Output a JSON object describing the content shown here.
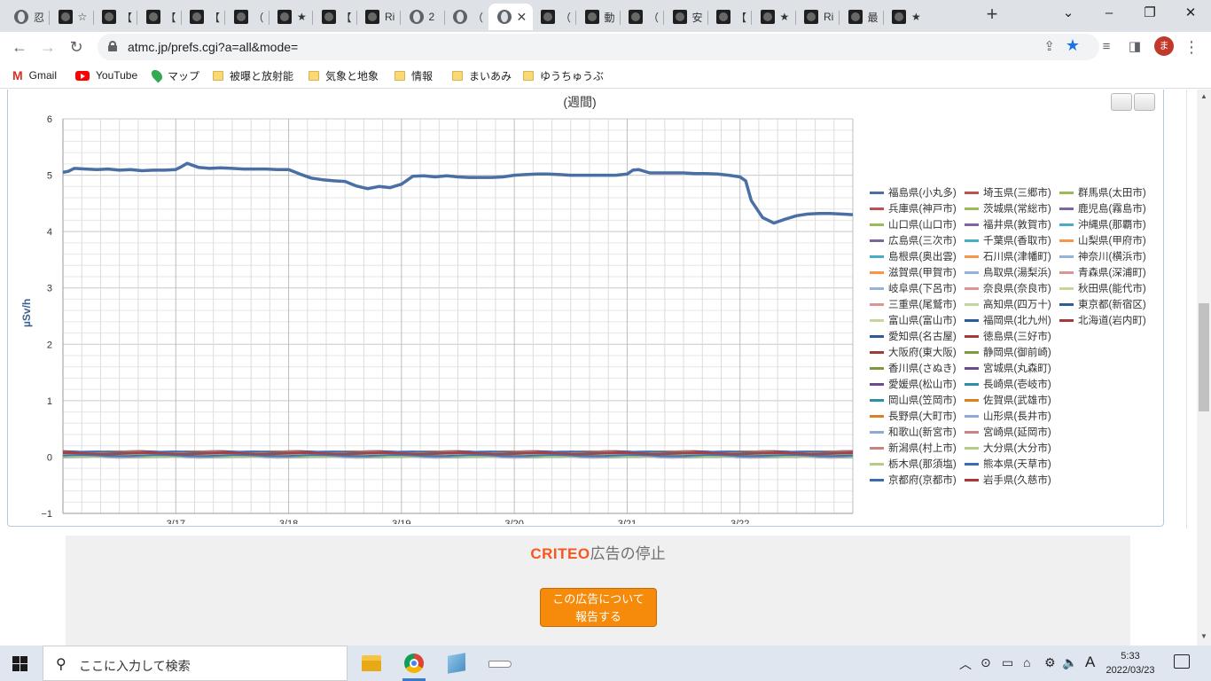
{
  "browser": {
    "tabs": [
      {
        "title": "忍",
        "icon": "globe-icon"
      },
      {
        "title": "☆",
        "icon": "site-favicon-icon"
      },
      {
        "title": "【",
        "icon": "site-favicon-icon"
      },
      {
        "title": "【",
        "icon": "site-favicon-icon"
      },
      {
        "title": "【",
        "icon": "site-favicon-icon"
      },
      {
        "title": "（",
        "icon": "site-favicon-icon"
      },
      {
        "title": "★",
        "icon": "site-favicon-icon"
      },
      {
        "title": "【",
        "icon": "site-favicon-icon"
      },
      {
        "title": "Ri",
        "icon": "site-favicon-icon"
      },
      {
        "title": "2",
        "icon": "globe-icon"
      },
      {
        "title": "（",
        "icon": "globe-icon"
      },
      {
        "title": "",
        "icon": "globe-icon",
        "active": true
      },
      {
        "title": "（",
        "icon": "site-favicon-icon"
      },
      {
        "title": "動",
        "icon": "site-favicon-icon"
      },
      {
        "title": "（",
        "icon": "site-favicon-icon"
      },
      {
        "title": "安",
        "icon": "site-favicon-icon"
      },
      {
        "title": "【",
        "icon": "site-favicon-icon"
      },
      {
        "title": "★",
        "icon": "site-favicon-icon"
      },
      {
        "title": "Ri",
        "icon": "site-favicon-icon"
      },
      {
        "title": "最",
        "icon": "site-favicon-icon"
      },
      {
        "title": "★",
        "icon": "site-favicon-icon"
      }
    ],
    "url": "atmc.jp/prefs.cgi?a=all&mode=",
    "profile_initial": "ま",
    "bookmarks": [
      {
        "label": "Gmail",
        "icon": "gmail-icon"
      },
      {
        "label": "YouTube",
        "icon": "youtube-icon"
      },
      {
        "label": "マップ",
        "icon": "maps-icon"
      },
      {
        "label": "被曝と放射能",
        "icon": "folder-icon"
      },
      {
        "label": "気象と地象",
        "icon": "folder-icon"
      },
      {
        "label": "情報",
        "icon": "folder-icon"
      },
      {
        "label": "まいあみ",
        "icon": "folder-icon"
      },
      {
        "label": "ゆうちゅうぶ",
        "icon": "folder-icon"
      }
    ]
  },
  "chart_data": {
    "type": "line",
    "title": "(週間)",
    "ylabel": "µSv/h",
    "xlabel": "",
    "ylim": [
      -1,
      6
    ],
    "yticks": [
      "6",
      "5",
      "4",
      "3",
      "2",
      "1",
      "0",
      "−1"
    ],
    "xticks": [
      "3/17",
      "3/18",
      "3/19",
      "3/20",
      "3/21",
      "3/22"
    ],
    "grid": true,
    "legend_position": "right",
    "series": [
      {
        "name": "福島県(小丸多)",
        "color": "#4a6fa5",
        "x": [
          16.0,
          16.05,
          16.1,
          16.2,
          16.3,
          16.4,
          16.5,
          16.6,
          16.7,
          16.8,
          16.9,
          17.0,
          17.05,
          17.1,
          17.2,
          17.3,
          17.4,
          17.5,
          17.6,
          17.7,
          17.8,
          17.9,
          18.0,
          18.1,
          18.2,
          18.3,
          18.4,
          18.5,
          18.6,
          18.7,
          18.8,
          18.9,
          19.0,
          19.1,
          19.2,
          19.3,
          19.4,
          19.5,
          19.6,
          19.7,
          19.8,
          19.9,
          20.0,
          20.1,
          20.2,
          20.3,
          20.4,
          20.5,
          20.6,
          20.7,
          20.8,
          20.9,
          21.0,
          21.05,
          21.1,
          21.2,
          21.3,
          21.4,
          21.5,
          21.6,
          21.7,
          21.8,
          21.9,
          22.0,
          22.05,
          22.1,
          22.2,
          22.3,
          22.4,
          22.5,
          22.6,
          22.7,
          22.8,
          22.9,
          23.0
        ],
        "y": [
          5.05,
          5.07,
          5.12,
          5.11,
          5.1,
          5.11,
          5.09,
          5.1,
          5.08,
          5.09,
          5.09,
          5.1,
          5.15,
          5.21,
          5.14,
          5.12,
          5.13,
          5.12,
          5.11,
          5.11,
          5.11,
          5.1,
          5.1,
          5.02,
          4.95,
          4.92,
          4.9,
          4.89,
          4.81,
          4.76,
          4.8,
          4.78,
          4.84,
          4.98,
          4.99,
          4.97,
          4.99,
          4.97,
          4.96,
          4.96,
          4.96,
          4.97,
          5.0,
          5.01,
          5.02,
          5.02,
          5.01,
          5.0,
          5.0,
          5.0,
          5.0,
          5.0,
          5.02,
          5.09,
          5.1,
          5.04,
          5.04,
          5.04,
          5.04,
          5.03,
          5.03,
          5.02,
          5.0,
          4.97,
          4.9,
          4.55,
          4.25,
          4.15,
          4.22,
          4.28,
          4.31,
          4.32,
          4.32,
          4.31,
          4.3
        ]
      },
      {
        "name": "埼玉県(三郷市)",
        "color": "#c0504d"
      },
      {
        "name": "群馬県(太田市)",
        "color": "#9bbb59"
      },
      {
        "name": "兵庫県(神戸市)",
        "color": "#c0504d"
      },
      {
        "name": "茨城県(常総市)",
        "color": "#9bbb59"
      },
      {
        "name": "鹿児島(霧島市)",
        "color": "#8064a2"
      },
      {
        "name": "山口県(山口市)",
        "color": "#9bbb59"
      },
      {
        "name": "福井県(敦賀市)",
        "color": "#8064a2"
      },
      {
        "name": "沖縄県(那覇市)",
        "color": "#4bacc6"
      },
      {
        "name": "広島県(三次市)",
        "color": "#8064a2"
      },
      {
        "name": "千葉県(香取市)",
        "color": "#4bacc6"
      },
      {
        "name": "山梨県(甲府市)",
        "color": "#f79646"
      },
      {
        "name": "島根県(奥出雲)",
        "color": "#4bacc6"
      },
      {
        "name": "石川県(津幡町)",
        "color": "#f79646"
      },
      {
        "name": "神奈川(横浜市)",
        "color": "#95b3d7"
      },
      {
        "name": "滋賀県(甲賀市)",
        "color": "#f79646"
      },
      {
        "name": "鳥取県(湯梨浜)",
        "color": "#95b3d7"
      },
      {
        "name": "青森県(深浦町)",
        "color": "#d99694"
      },
      {
        "name": "岐阜県(下呂市)",
        "color": "#95b3d7"
      },
      {
        "name": "奈良県(奈良市)",
        "color": "#d99694"
      },
      {
        "name": "秋田県(能代市)",
        "color": "#c3d69b"
      },
      {
        "name": "三重県(尾鷲市)",
        "color": "#d99694"
      },
      {
        "name": "高知県(四万十)",
        "color": "#c3d69b"
      },
      {
        "name": "東京都(新宿区)",
        "color": "#2e5b9a"
      },
      {
        "name": "富山県(富山市)",
        "color": "#c3d69b"
      },
      {
        "name": "福岡県(北九州)",
        "color": "#2e5b9a"
      },
      {
        "name": "北海道(岩内町)",
        "color": "#a33b3b"
      },
      {
        "name": "愛知県(名古屋)",
        "color": "#2e5b9a"
      },
      {
        "name": "徳島県(三好市)",
        "color": "#a33b3b"
      },
      {
        "name": "大阪府(東大阪)",
        "color": "#a33b3b"
      },
      {
        "name": "静岡県(御前崎)",
        "color": "#7a9a3b"
      },
      {
        "name": "香川県(さぬき)",
        "color": "#7a9a3b"
      },
      {
        "name": "宮城県(丸森町)",
        "color": "#6a4c8c"
      },
      {
        "name": "愛媛県(松山市)",
        "color": "#6a4c8c"
      },
      {
        "name": "長崎県(壱岐市)",
        "color": "#2f8fa8"
      },
      {
        "name": "岡山県(笠岡市)",
        "color": "#2f8fa8"
      },
      {
        "name": "佐賀県(武雄市)",
        "color": "#e07f22"
      },
      {
        "name": "長野県(大町市)",
        "color": "#e07f22"
      },
      {
        "name": "山形県(長井市)",
        "color": "#8eaad4"
      },
      {
        "name": "和歌山(新宮市)",
        "color": "#8eaad4"
      },
      {
        "name": "宮崎県(延岡市)",
        "color": "#c98482"
      },
      {
        "name": "新潟県(村上市)",
        "color": "#c98482"
      },
      {
        "name": "大分県(大分市)",
        "color": "#b3cc86"
      },
      {
        "name": "栃木県(那須塩)",
        "color": "#b3cc86"
      },
      {
        "name": "熊本県(天草市)",
        "color": "#3a6cb3"
      },
      {
        "name": "京都府(京都市)",
        "color": "#3a6cb3"
      },
      {
        "name": "岩手県(久慈市)",
        "color": "#b03434"
      }
    ],
    "other_series_range": [
      0.0,
      0.12
    ]
  },
  "ad": {
    "brand": "CRITEO",
    "stop_text": "広告の停止",
    "report_button": [
      "この広告について",
      "報告する"
    ]
  },
  "taskbar": {
    "search_placeholder": "ここに入力して検索",
    "ime_label": "A",
    "time": "5:33",
    "date": "2022/03/23"
  }
}
